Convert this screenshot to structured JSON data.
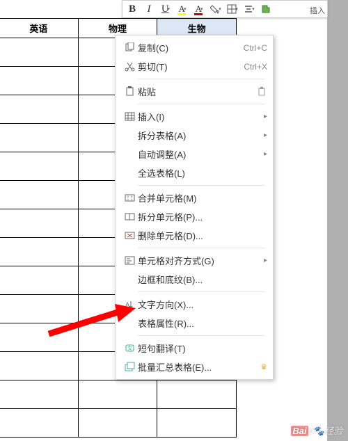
{
  "headers": [
    "英语",
    "物理",
    "生物"
  ],
  "side_label": "插入",
  "toolbar": {
    "bold": "B",
    "italic": "I",
    "underline": "U",
    "fontA": "A",
    "fontA2": "A"
  },
  "menu": {
    "copy": {
      "label": "复制(C)",
      "shortcut": "Ctrl+C"
    },
    "cut": {
      "label": "剪切(T)",
      "shortcut": "Ctrl+X"
    },
    "paste": {
      "label": "粘贴"
    },
    "insert": {
      "label": "插入(I)"
    },
    "split_table": {
      "label": "拆分表格(A)"
    },
    "auto_fit": {
      "label": "自动调整(A)"
    },
    "select_all": {
      "label": "全选表格(L)"
    },
    "merge_cells": {
      "label": "合并单元格(M)"
    },
    "split_cells": {
      "label": "拆分单元格(P)..."
    },
    "delete_cells": {
      "label": "删除单元格(D)..."
    },
    "cell_align": {
      "label": "单元格对齐方式(G)"
    },
    "borders": {
      "label": "边框和底纹(B)..."
    },
    "text_dir": {
      "label": "文字方向(X)..."
    },
    "table_props": {
      "label": "表格属性(R)..."
    },
    "translate": {
      "label": "短句翻译(T)"
    },
    "batch": {
      "label": "批量汇总表格(E)..."
    }
  },
  "watermark": "经验"
}
